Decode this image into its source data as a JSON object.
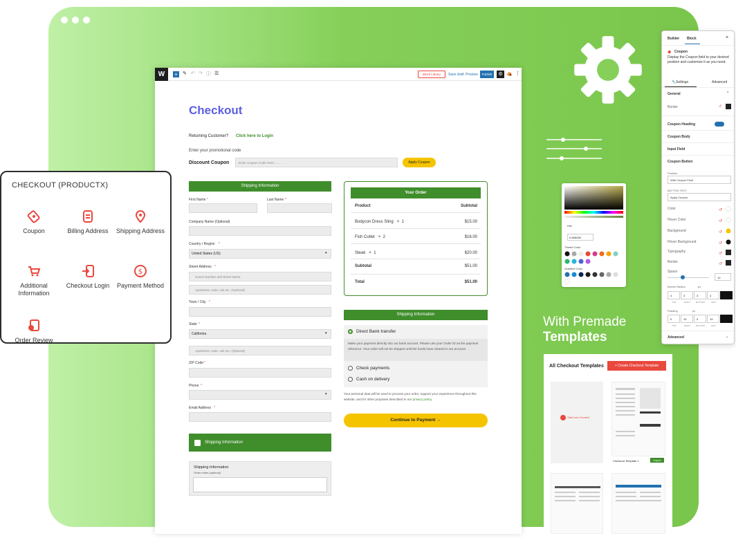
{
  "checkout_title": "Checkout",
  "returning": "Returning Customer?",
  "login_link": "Click here to Login",
  "promo_text": "Enter your promotional code",
  "discount_label": "Discount Coupon",
  "coupon_placeholder": "Enter Coupon Code Here........",
  "apply_coupon": "Apply Coupon",
  "toolbar": {
    "block_library": "Block Library",
    "save_draft": "Save draft",
    "preview": "Preview",
    "publish": "Publish"
  },
  "shipping_info": "Shipping Information",
  "fields": {
    "first_name": "First Name",
    "last_name": "Last Name",
    "company": "Company Name (Optional)",
    "country": "Country / Region",
    "country_val": "United States (US)",
    "street": "Street Address",
    "street_ph1": "House Number and Street Name",
    "street_ph2": "Apartment, suite, unit etc. (Optional)",
    "town": "Town / City",
    "state": "State",
    "state_val": "California",
    "apt_ph": "Apartment, suite, unit etc. (Optional)",
    "zip": "ZIP Code",
    "phone": "Phone",
    "email": "Email Address"
  },
  "required_mark": "*",
  "order": {
    "title": "Your Order",
    "product": "Product",
    "subtotal": "Subtotal",
    "items": [
      {
        "name": "Bodycon Dress Sling",
        "qty": "1",
        "price": "$15.00"
      },
      {
        "name": "Fish Cutlet",
        "qty": "2",
        "price": "$16.00"
      },
      {
        "name": "Steak",
        "qty": "1",
        "price": "$20.00"
      }
    ],
    "subtotal_label": "Subtotal",
    "subtotal_val": "$51.00",
    "total_label": "Total",
    "total_val": "$51.00",
    "times": "×"
  },
  "payment": {
    "header": "Shipping Information",
    "bank": "Direct Bank transfer",
    "bank_desc": "Make your payment directly into our bank account. Please use your Order ID as the payment reference. Your order will not be shipped until the funds have cleared in our account.",
    "check": "Check payments",
    "cod": "Cash on delivery",
    "privacy": "Your personal data will be used to process your order, support your experience throughout this website, and for other purposes described in our",
    "privacy_link": "privacy policy.",
    "button": "Continue to Payment →"
  },
  "ship_box": "Shipping Information",
  "notes": {
    "title": "Shipping Information",
    "sub": "Order notes (optional)"
  },
  "left_card": {
    "title": "CHECKOUT (PRODUCTX)",
    "items": [
      {
        "label": "Coupon",
        "icon": "coupon-icon"
      },
      {
        "label": "Billing Address",
        "icon": "billing-icon"
      },
      {
        "label": "Shipping Address",
        "icon": "pin-icon"
      },
      {
        "label": "Additional Information",
        "icon": "cart-icon"
      },
      {
        "label": "Checkout Login",
        "icon": "login-icon"
      },
      {
        "label": "Payment Method",
        "icon": "dollar-icon"
      },
      {
        "label": "Order Review",
        "icon": "review-icon"
      }
    ]
  },
  "premade_line1": "With Premade",
  "premade_line2": "Templates",
  "templates": {
    "title": "All Checkout Templates",
    "create": "+ Create Checkout Template",
    "start": "Start from Scratch",
    "item_name": "Checkout Template 1",
    "import": "Import"
  },
  "picker": {
    "mode": "Hex",
    "hex": "# 668438",
    "theme_colors": "Theme Color",
    "preset": "Gradient Color"
  },
  "panel": {
    "tab_builder": "Builder",
    "tab_block": "Block",
    "close": "×",
    "block_name": "Coupon",
    "block_desc": "Display the Coupon field to your desired position and customize it as you need.",
    "settings": "Settings",
    "advanced": "Advanced",
    "general": "General",
    "border": "Border",
    "coupon_heading": "Coupon Heading",
    "coupon_body": "Coupon Body",
    "input_field": "Input Field",
    "coupon_button": "Coupon Button",
    "position": "Position",
    "position_val": "With Coupon Field",
    "button_text": "BUTTON TEXT",
    "button_text_val": "Apply Coupon",
    "color": "Color",
    "hover_color": "Hover Color",
    "background": "Background",
    "hover_background": "Hover Background",
    "typography": "Typography",
    "border2": "Border",
    "space": "Space",
    "space_val": "10",
    "border_radius": "Border Radius",
    "radius_unit": "px",
    "radius_vals": [
      "4",
      "4",
      "4",
      "4"
    ],
    "padding": "Padding",
    "padding_unit": "px",
    "padding_vals": [
      "0",
      "19",
      "0",
      "19"
    ],
    "sides": [
      "TOP",
      "RIGHT",
      "BOTTOM",
      "LEFT"
    ],
    "advanced2": "Advanced"
  },
  "colors": {
    "accent": "#3f8d2b",
    "title": "#5b5fe0",
    "cta": "#f5c400",
    "red": "#e9483d",
    "link": "#2271b1"
  }
}
